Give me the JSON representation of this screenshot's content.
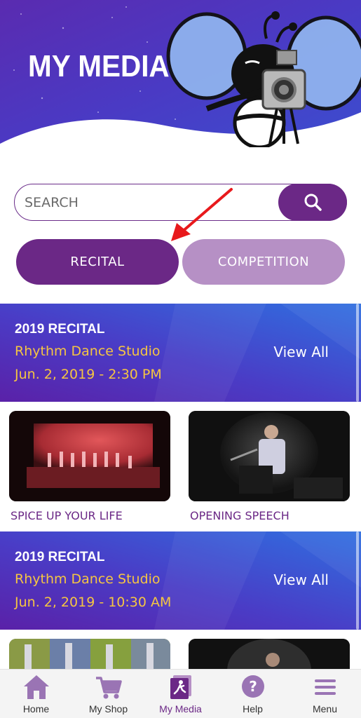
{
  "header": {
    "title": "MY MEDIA"
  },
  "search": {
    "placeholder": "SEARCH",
    "value": ""
  },
  "tabs": [
    {
      "label": "RECITAL",
      "active": true
    },
    {
      "label": "COMPETITION",
      "active": false
    }
  ],
  "events": [
    {
      "title": "2019 RECITAL",
      "studio": "Rhythm Dance Studio",
      "date": "Jun. 2, 2019 - 2:30 PM",
      "view_all": "View All",
      "videos": [
        {
          "title": "SPICE UP YOUR LIFE"
        },
        {
          "title": "OPENING SPEECH"
        }
      ]
    },
    {
      "title": "2019 RECITAL",
      "studio": "Rhythm Dance Studio",
      "date": "Jun. 2, 2019 - 10:30 AM",
      "view_all": "View All",
      "videos": [
        {
          "title": ""
        },
        {
          "title": ""
        }
      ]
    }
  ],
  "bottom_nav": [
    {
      "label": "Home",
      "icon": "home-icon"
    },
    {
      "label": "My Shop",
      "icon": "cart-icon"
    },
    {
      "label": "My Media",
      "icon": "media-icon",
      "active": true
    },
    {
      "label": "Help",
      "icon": "help-icon"
    },
    {
      "label": "Menu",
      "icon": "menu-icon"
    }
  ],
  "colors": {
    "primary_purple": "#6b2886",
    "light_purple": "#b690c5",
    "accent_yellow": "#f5c542",
    "banner_blue": "#3a5bd6"
  }
}
